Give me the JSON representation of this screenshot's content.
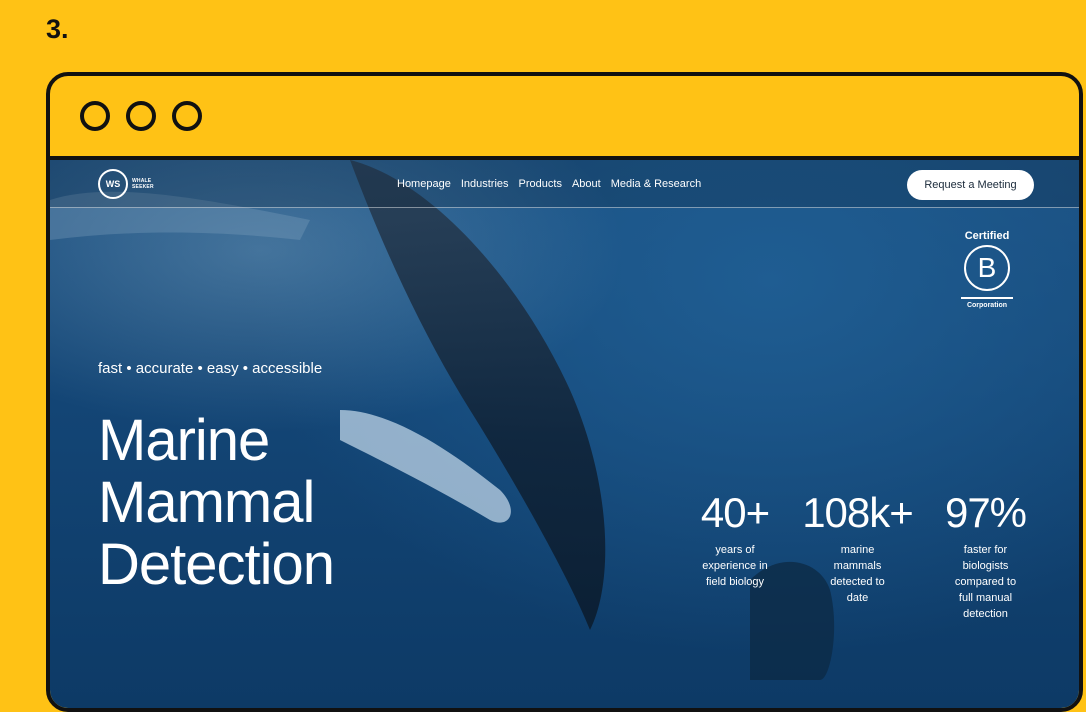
{
  "step": {
    "number": "3."
  },
  "site": {
    "logo": {
      "mark": "WS",
      "name": "WHALE SEEKER"
    },
    "nav": {
      "links": [
        "Homepage",
        "Industries",
        "Products",
        "About",
        "Media & Research"
      ],
      "cta": "Request a Meeting"
    },
    "badge": {
      "top": "Certified",
      "letter": "B",
      "bottom": "Corporation"
    },
    "hero": {
      "tagline": "fast • accurate • easy • accessible",
      "headline": [
        "Marine",
        "Mammal",
        "Detection"
      ]
    },
    "stats": [
      {
        "value": "40+",
        "description": "years of experience in field biology"
      },
      {
        "value": "108k+",
        "description": "marine mammals detected to date"
      },
      {
        "value": "97%",
        "description": "faster for biologists compared to full manual detection"
      }
    ]
  },
  "colors": {
    "background": "#FFC215",
    "frame": "#111111",
    "ocean": "#134575",
    "text": "#FFFFFF"
  }
}
